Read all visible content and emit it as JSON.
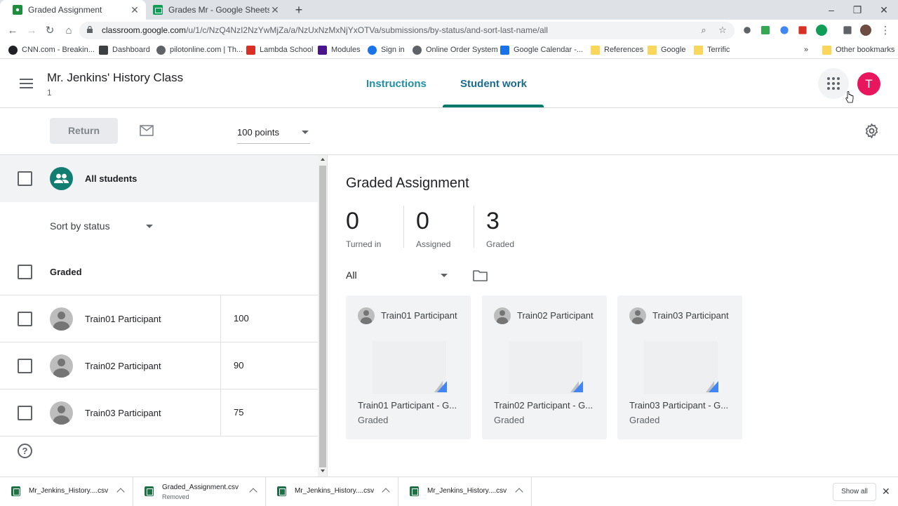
{
  "browser": {
    "tabs": [
      {
        "title": "Graded Assignment",
        "active": true,
        "icon": "classroom-icon"
      },
      {
        "title": "Grades Mr - Google Sheets",
        "active": false,
        "icon": "sheets-icon"
      }
    ],
    "url_host": "classroom.google.com",
    "url_path": "/u/1/c/NzQ4NzI2NzYwMjZa/a/NzUxNzMxNjYxOTVa/submissions/by-status/and-sort-last-name/all",
    "bookmarks": [
      "CNN.com - Breakin...",
      "Dashboard",
      "pilotonline.com | Th...",
      "Lambda School",
      "Modules",
      "Sign in",
      "Online Order System",
      "Google Calendar -...",
      "References",
      "Google",
      "Terrific"
    ],
    "bookmarks_more": "»",
    "other_bookmarks": "Other bookmarks"
  },
  "header": {
    "class_title": "Mr. Jenkins' History Class",
    "class_section": "1",
    "tabs": [
      "Instructions",
      "Student work"
    ],
    "avatar_letter": "T",
    "accent_color": "#00796b",
    "avatar_color": "#e8175d"
  },
  "actions": {
    "return_label": "Return",
    "points_value": "100 points"
  },
  "left": {
    "all_students_label": "All students",
    "sort_label": "Sort by status",
    "section_label": "Graded",
    "students": [
      {
        "name": "Train01 Participant",
        "grade": "100"
      },
      {
        "name": "Train02 Participant",
        "grade": "90"
      },
      {
        "name": "Train03 Participant",
        "grade": "75"
      }
    ],
    "help_glyph": "?"
  },
  "right": {
    "assignment_title": "Graded Assignment",
    "stats": [
      {
        "value": "0",
        "label": "Turned in"
      },
      {
        "value": "0",
        "label": "Assigned"
      },
      {
        "value": "3",
        "label": "Graded"
      }
    ],
    "filter_value": "All",
    "cards": [
      {
        "name": "Train01 Participant",
        "file": "Train01 Participant - G...",
        "status": "Graded"
      },
      {
        "name": "Train02 Participant",
        "file": "Train02 Participant - G...",
        "status": "Graded"
      },
      {
        "name": "Train03 Participant",
        "file": "Train03 Participant - G...",
        "status": "Graded"
      }
    ]
  },
  "downloads": {
    "items": [
      {
        "name": "Mr_Jenkins_History....csv",
        "sub": ""
      },
      {
        "name": "Graded_Assignment.csv",
        "sub": "Removed"
      },
      {
        "name": "Mr_Jenkins_History....csv",
        "sub": ""
      },
      {
        "name": "Mr_Jenkins_History....csv",
        "sub": ""
      }
    ],
    "show_all": "Show all"
  }
}
